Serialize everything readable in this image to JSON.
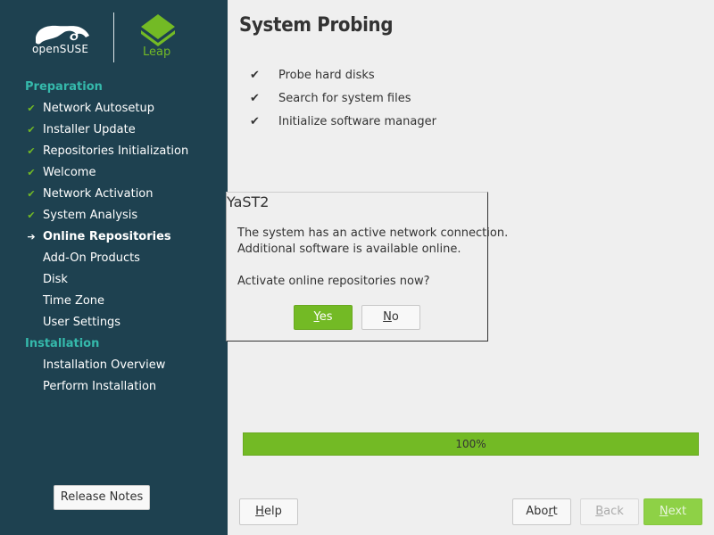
{
  "logo": {
    "brand_text": "openSUSE",
    "leap_text": "Leap"
  },
  "sidebar": {
    "headings": [
      "Preparation",
      "Installation"
    ],
    "preparation_steps": [
      {
        "label": "Network Autosetup",
        "state": "done"
      },
      {
        "label": "Installer Update",
        "state": "done"
      },
      {
        "label": "Repositories Initialization",
        "state": "done"
      },
      {
        "label": "Welcome",
        "state": "done"
      },
      {
        "label": "Network Activation",
        "state": "done"
      },
      {
        "label": "System Analysis",
        "state": "done"
      },
      {
        "label": "Online Repositories",
        "state": "current"
      },
      {
        "label": "Add-On Products",
        "state": "pending"
      },
      {
        "label": "Disk",
        "state": "pending"
      },
      {
        "label": "Time Zone",
        "state": "pending"
      },
      {
        "label": "User Settings",
        "state": "pending"
      }
    ],
    "installation_steps": [
      {
        "label": "Installation Overview",
        "state": "pending"
      },
      {
        "label": "Perform Installation",
        "state": "pending"
      }
    ],
    "release_notes_label": "Release Notes"
  },
  "main": {
    "title": "System Probing",
    "probe_items": [
      {
        "check": "✔",
        "label": "Probe hard disks"
      },
      {
        "check": "✔",
        "label": "Search for system files"
      },
      {
        "check": "✔",
        "label": "Initialize software manager"
      }
    ],
    "progress_label": "100%",
    "progress_fraction": 1.0
  },
  "dialog": {
    "title": "YaST2",
    "line1": "The system has an active network connection.",
    "line2": "Additional software is available online.",
    "line3": "Activate online repositories now?",
    "yes_label": "Yes",
    "no_label": "No"
  },
  "footer": {
    "help_label": "Help",
    "abort_label": "Abort",
    "back_label": "Back",
    "next_label": "Next"
  },
  "colors": {
    "sidebar_bg": "#1e4150",
    "accent_green": "#73ba25",
    "heading_teal": "#35b9ab"
  },
  "icons": {
    "done": "check-icon",
    "current": "arrow-right-icon"
  }
}
